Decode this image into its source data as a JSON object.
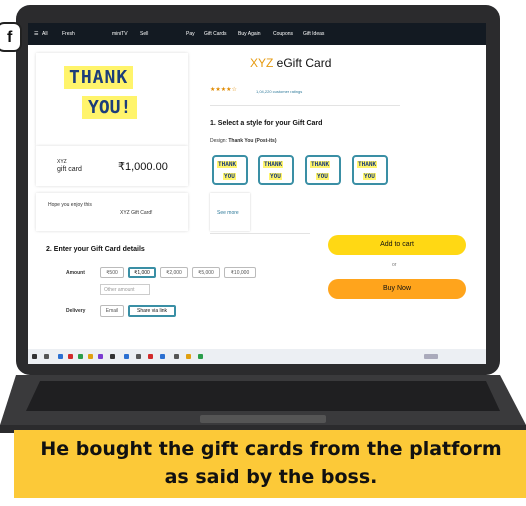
{
  "nav": {
    "menu_label": "All",
    "items": [
      "Fresh",
      "miniTV",
      "Sell",
      "Pay",
      "Gift Cards",
      "Buy Again",
      "Coupons",
      "Gift Ideas"
    ]
  },
  "badge": "f",
  "product": {
    "brand": "XYZ",
    "title_rest": " eGift Card",
    "stars": "★★★★☆",
    "ratings": "1,04,220 customer ratings"
  },
  "card_preview": {
    "line1": "THANK",
    "line2": "YOU!",
    "type_top": "XYZ",
    "type_bottom": "gift card",
    "price": "₹1,000.00",
    "message_line1": "Hope you enjoy this",
    "message_line2": "XYZ Gift Card!"
  },
  "styles": {
    "heading": "1. Select a style for your Gift Card",
    "design_label": "Design:",
    "design_value": "Thank You (Post-its)",
    "tile_line1": "THANK",
    "tile_line2": "YOU",
    "see_more": "See more"
  },
  "details": {
    "heading": "2. Enter your Gift Card details",
    "amount_label": "Amount",
    "amounts": [
      "₹500",
      "₹1,000",
      "₹2,000",
      "₹5,000",
      "₹10,000"
    ],
    "selected_amount": "₹1,000",
    "other_placeholder": "Other amount",
    "delivery_label": "Delivery",
    "delivery_options": [
      "Email",
      "Share via link"
    ],
    "selected_delivery": "Share via link"
  },
  "actions": {
    "add_to_cart": "Add to cart",
    "or": "or",
    "buy_now": "Buy Now"
  },
  "caption": {
    "line1": "He bought the gift cards from the platform",
    "line2": "as said by the boss."
  },
  "colors": {
    "nav_bg": "#131a22",
    "add_to_cart": "#ffd814",
    "buy_now": "#ffa41c",
    "caption_bg": "#fcc938",
    "selection": "#3a8fa5"
  }
}
